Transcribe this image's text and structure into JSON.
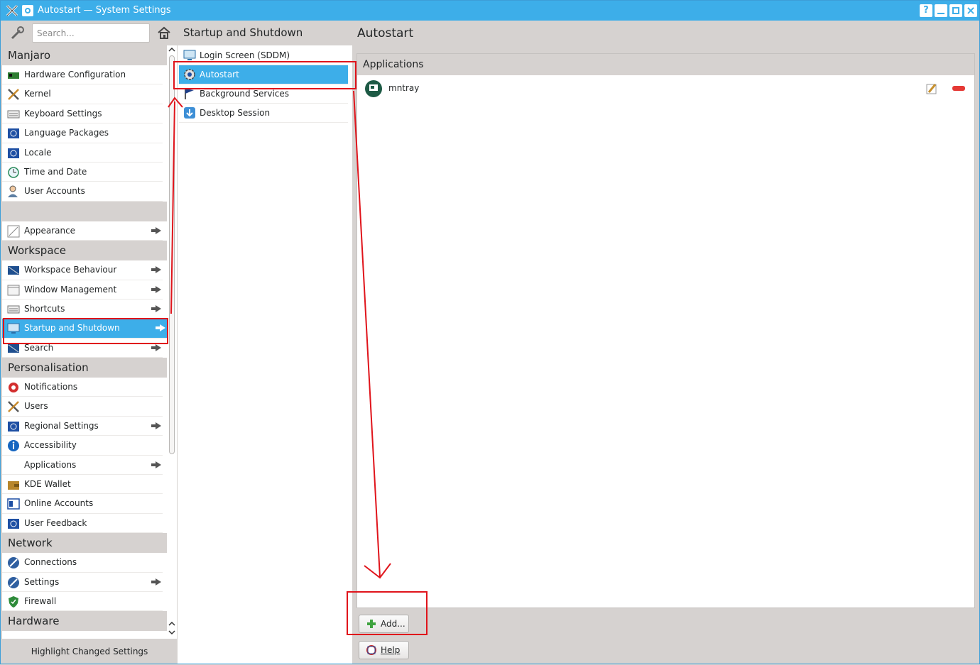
{
  "window": {
    "title": "Autostart — System Settings",
    "help_label": "?"
  },
  "search": {
    "placeholder": "Search..."
  },
  "sidebar": {
    "sections": [
      {
        "header": "Manjaro",
        "items": [
          "Hardware Configuration",
          "Kernel",
          "Keyboard Settings",
          "Language Packages",
          "Locale",
          "Time and Date",
          "User Accounts"
        ]
      },
      {
        "header": "",
        "items": [
          "Appearance"
        ]
      },
      {
        "header": "Workspace",
        "items": [
          "Workspace Behaviour",
          "Window Management",
          "Shortcuts",
          "Startup and Shutdown",
          "Search"
        ]
      },
      {
        "header": "Personalisation",
        "items": [
          "Notifications",
          "Users",
          "Regional Settings",
          "Accessibility",
          "Applications",
          "KDE Wallet",
          "Online Accounts",
          "User Feedback"
        ]
      },
      {
        "header": "Network",
        "items": [
          "Connections",
          "Settings",
          "Firewall"
        ]
      },
      {
        "header": "Hardware",
        "items": []
      }
    ],
    "highlight_changed": "Highlight Changed Settings"
  },
  "middle": {
    "title": "Startup and Shutdown",
    "items": [
      "Login Screen (SDDM)",
      "Autostart",
      "Background Services",
      "Desktop Session"
    ]
  },
  "right": {
    "title": "Autostart",
    "panel_header": "Applications",
    "apps": [
      {
        "name": "mntray"
      }
    ],
    "add_label": "Add...",
    "help_label": "Help"
  },
  "colors": {
    "accent": "#3daee9",
    "annotation": "#e0141b"
  }
}
